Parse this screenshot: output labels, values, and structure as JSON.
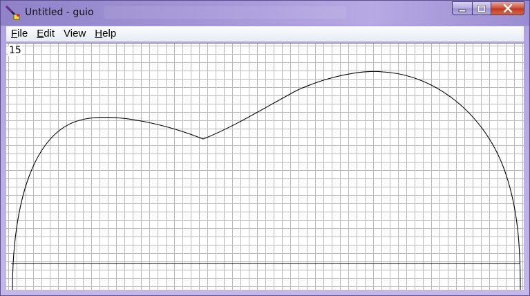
{
  "window": {
    "title": "Untitled - guio",
    "app_icon": "pen-icon"
  },
  "caption_buttons": [
    {
      "name": "minimize-button",
      "icon": "minimize-icon"
    },
    {
      "name": "maximize-button",
      "icon": "maximize-icon"
    },
    {
      "name": "close-button",
      "icon": "close-icon"
    }
  ],
  "menu": {
    "file": {
      "mnemonic": "F",
      "rest": "ile"
    },
    "edit": {
      "mnemonic": "E",
      "rest": "dit"
    },
    "view": {
      "label": "View"
    },
    "help": {
      "mnemonic": "H",
      "rest": "elp"
    }
  },
  "canvas": {
    "counter": "15",
    "background": "#ffffff",
    "grid_color": "#b9b9b9",
    "curve_color": "#000000"
  }
}
